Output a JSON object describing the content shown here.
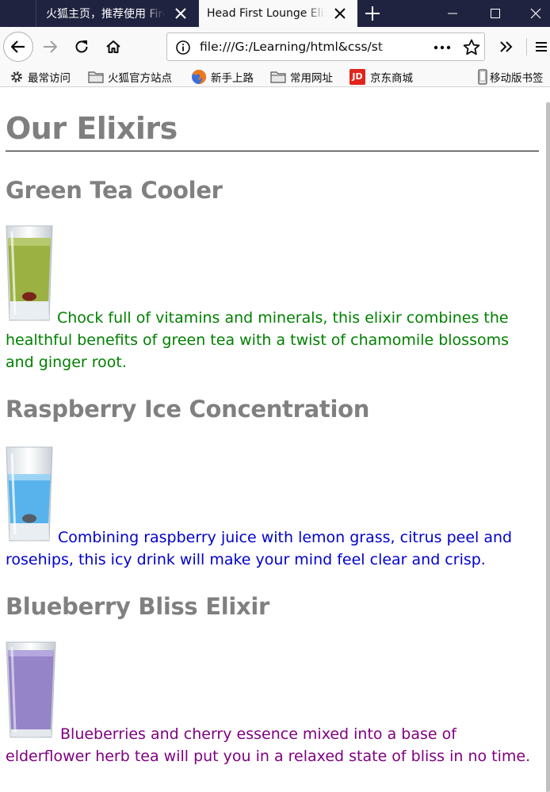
{
  "browser": {
    "tabs": [
      {
        "title": "火狐主页，推荐使用 Firefox",
        "active": false
      },
      {
        "title": "Head First Lounge Elixirs",
        "active": true
      }
    ],
    "url": "file:///G:/Learning/html&css/st",
    "bookmarks": [
      "最常访问",
      "火狐官方站点",
      "新手上路",
      "常用网址",
      "京东商城",
      "移动版书签"
    ],
    "jd_logo": "JD",
    "icons": [
      "back-icon",
      "forward-icon",
      "reload-icon",
      "home-icon",
      "info-icon",
      "page-actions-icon",
      "star-icon",
      "overflow-icon",
      "menu-icon",
      "minimize-icon",
      "maximize-icon",
      "close-icon",
      "new-tab-icon"
    ]
  },
  "page": {
    "title": "Our Elixirs",
    "drinks": [
      {
        "name": "Green Tea Cooler",
        "color": "#008000",
        "desc_lines": [
          "Chock full of vitamins and minerals, this elixir combines the",
          "healthful benefits of green tea with a twist of chamomile blossoms",
          "and ginger root."
        ]
      },
      {
        "name": "Raspberry Ice Concentration",
        "color": "#0000cd",
        "desc_lines": [
          "Combining raspberry juice with lemon grass, citrus peel and",
          "rosehips, this icy drink will make your mind feel clear and crisp."
        ]
      },
      {
        "name": "Blueberry Bliss Elixir",
        "color": "#800080",
        "desc_lines": [
          "Blueberries and cherry essence mixed into a base of",
          "elderflower herb tea will put you in a relaxed state of bliss in no time."
        ]
      }
    ]
  }
}
